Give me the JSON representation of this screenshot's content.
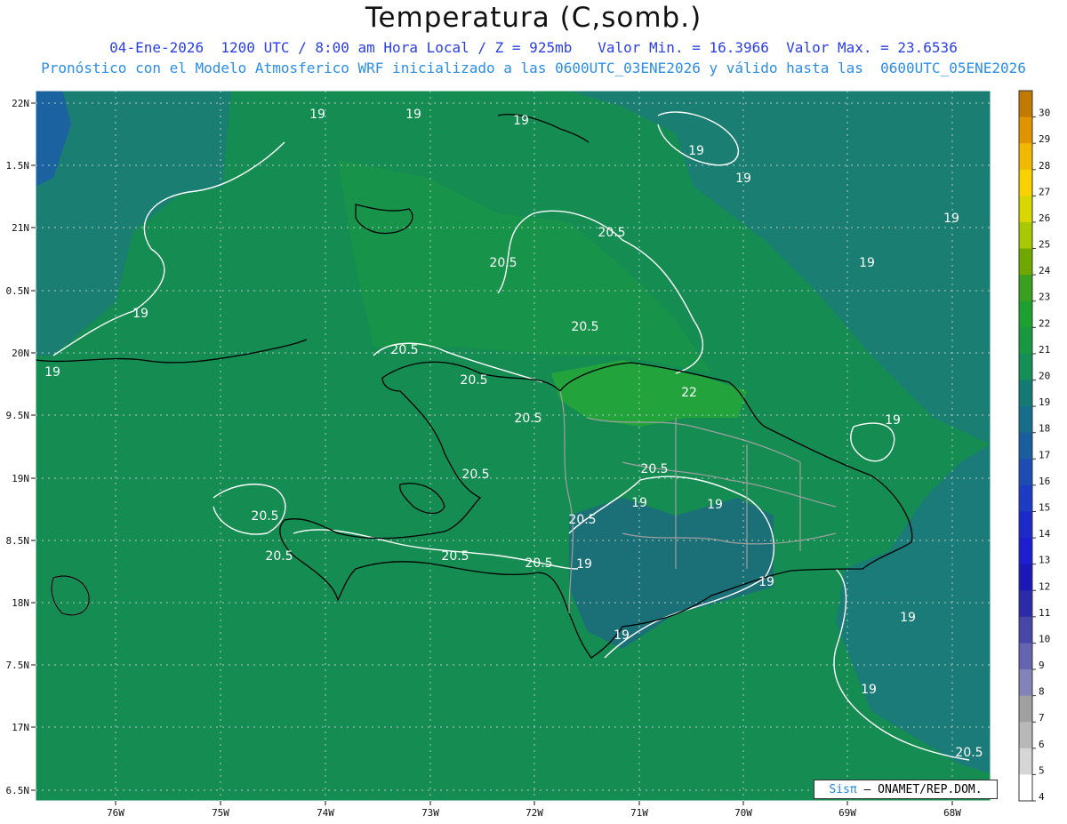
{
  "title": "Temperatura (C,somb.)",
  "subtitle_line1": "04-Ene-2026  1200 UTC / 8:00 am Hora Local / Z = 925mb   Valor Min. = 16.3966  Valor Max. = 23.6536",
  "subtitle_line2": "Pronóstico con el Modelo Atmosferico WRF inicializado a las 0600UTC_03ENE2026 y válido hasta las  0600UTC_05ENE2026",
  "credit": {
    "prefix": "Sisπ",
    "suffix": " – ONAMET/REP.DOM."
  },
  "axes": {
    "lon_labels": [
      "76W",
      "75W",
      "74W",
      "73W",
      "72W",
      "71W",
      "70W",
      "69W",
      "68W"
    ],
    "lat_labels": [
      "22N",
      "1.5N",
      "21N",
      "0.5N",
      "20N",
      "9.5N",
      "19N",
      "8.5N",
      "18N",
      "7.5N",
      "17N",
      "6.5N"
    ]
  },
  "contour_labels": [
    "19",
    "19",
    "19",
    "19",
    "19",
    "19",
    "19",
    "19",
    "19",
    "19",
    "19",
    "19",
    "19",
    "19",
    "19",
    "19",
    "19",
    "20.5",
    "20.5",
    "20.5",
    "20.5",
    "20.5",
    "20.5",
    "20.5",
    "20.5",
    "20.5",
    "20.5",
    "20.5",
    "20.5",
    "20.5",
    "20.5",
    "22"
  ],
  "colorbar": {
    "labels": [
      "30",
      "29",
      "28",
      "27",
      "26",
      "25",
      "24",
      "23",
      "22",
      "21",
      "20",
      "19",
      "18",
      "17",
      "16",
      "15",
      "14",
      "13",
      "12",
      "11",
      "10",
      "9",
      "8",
      "7",
      "6",
      "5",
      "4"
    ],
    "colors": [
      "#c07a00",
      "#e09400",
      "#f0b800",
      "#f7d200",
      "#d8d800",
      "#a8c800",
      "#70a800",
      "#3aa020",
      "#1ea030",
      "#189840",
      "#168e58",
      "#137a74",
      "#176e8c",
      "#1a5e9e",
      "#1d4cb2",
      "#1d3cc4",
      "#1d2ac8",
      "#1e1ed0",
      "#1c18b8",
      "#2b2ba8",
      "#4747a8",
      "#6464b0",
      "#8383b8",
      "#a0a0a0",
      "#b8b8b8",
      "#d6d6d6",
      "#ffffff"
    ]
  },
  "colors": {
    "map_green": "#158c52",
    "light_green": "#23a142",
    "teal": "#1b7c75",
    "contour_line": "#ffffff",
    "coast": "#000000",
    "border": "#a0a0a0"
  }
}
